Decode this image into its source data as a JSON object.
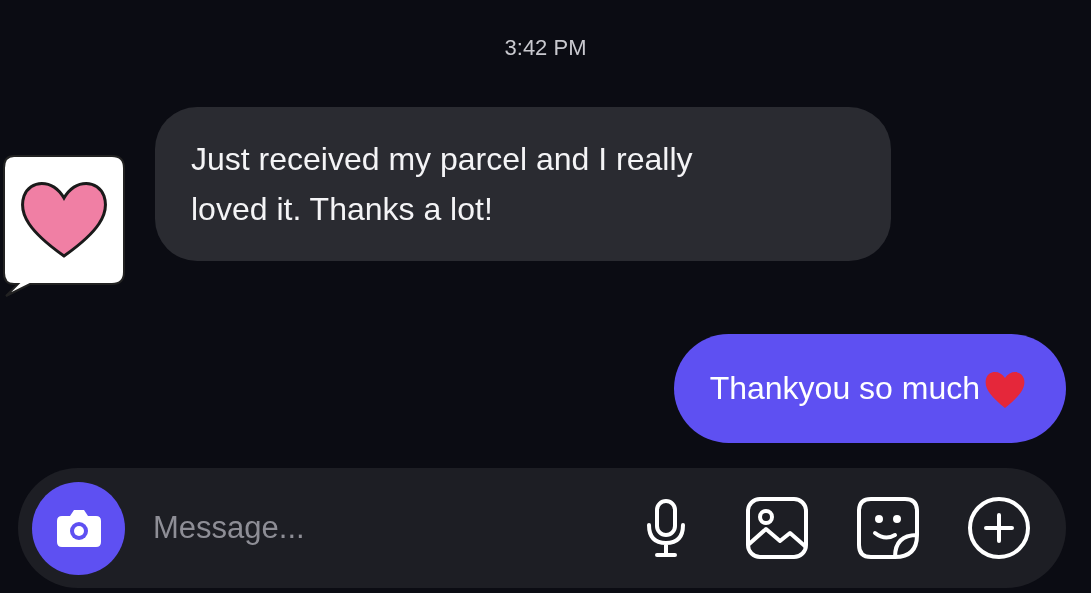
{
  "timestamp": "3:42 PM",
  "messages": [
    {
      "kind": "incoming",
      "text": "Just received my parcel and I really loved it. Thanks a lot!"
    },
    {
      "kind": "outgoing",
      "text": "Thankyou so much"
    }
  ],
  "composer": {
    "placeholder": "Message..."
  }
}
